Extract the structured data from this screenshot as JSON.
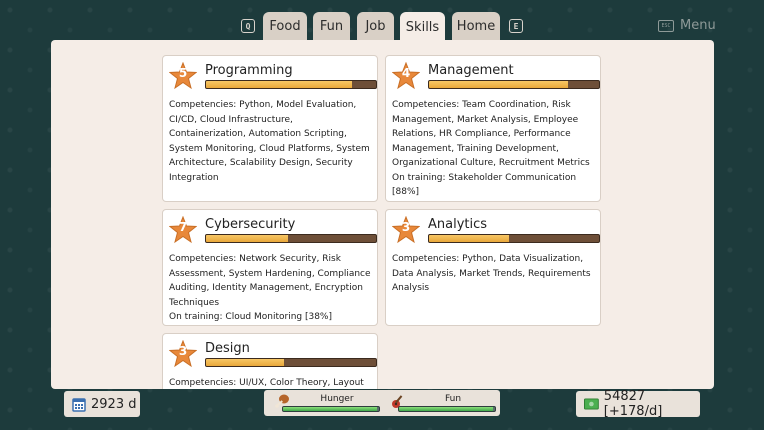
{
  "nav": {
    "left_key": "Q",
    "right_key": "E",
    "tabs": [
      {
        "label": "Food",
        "active": false
      },
      {
        "label": "Fun",
        "active": false
      },
      {
        "label": "Job",
        "active": false
      },
      {
        "label": "Skills",
        "active": true
      },
      {
        "label": "Home",
        "active": false
      }
    ],
    "menu_key": "ESC",
    "menu_label": "Menu"
  },
  "skills": [
    {
      "level": "5",
      "name": "Programming",
      "progress": 0.86,
      "competencies": "Competencies: Python, Model Evaluation, CI/CD, Cloud Infrastructure, Containerization, Automation Scripting, System Monitoring, Cloud Platforms, System Architecture, Scalability Design, Security Integration",
      "training": ""
    },
    {
      "level": "4",
      "name": "Management",
      "progress": 0.82,
      "competencies": "Competencies: Team Coordination, Risk Management, Market Analysis, Employee Relations, HR Compliance, Performance Management, Training Development, Organizational Culture, Recruitment Metrics",
      "training": "On training: Stakeholder Communication [88%]"
    },
    {
      "level": "7",
      "name": "Cybersecurity",
      "progress": 0.48,
      "competencies": "Competencies: Network Security, Risk Assessment, System Hardening, Compliance Auditing, Identity Management, Encryption Techniques",
      "training": "On training: Cloud Monitoring [38%]"
    },
    {
      "level": "3",
      "name": "Analytics",
      "progress": 0.47,
      "competencies": "Competencies: Python, Data Visualization, Data Analysis, Market Trends, Requirements Analysis",
      "training": ""
    },
    {
      "level": "3",
      "name": "Design",
      "progress": 0.46,
      "competencies": "Competencies: UI/UX, Color Theory, Layout",
      "training": ""
    }
  ],
  "status": {
    "days": "2923 d",
    "hunger_label": "Hunger",
    "hunger_level": 0.98,
    "fun_label": "Fun",
    "fun_level": 0.98,
    "money": "54827 [+178/d]"
  },
  "colors": {
    "background": "#1d3b3c",
    "panel": "#f5ede7",
    "star": "#e8883a",
    "bar_fill": "#f0b84f",
    "bar_track": "#6e4f38",
    "need_fill": "#5ccb5a"
  }
}
